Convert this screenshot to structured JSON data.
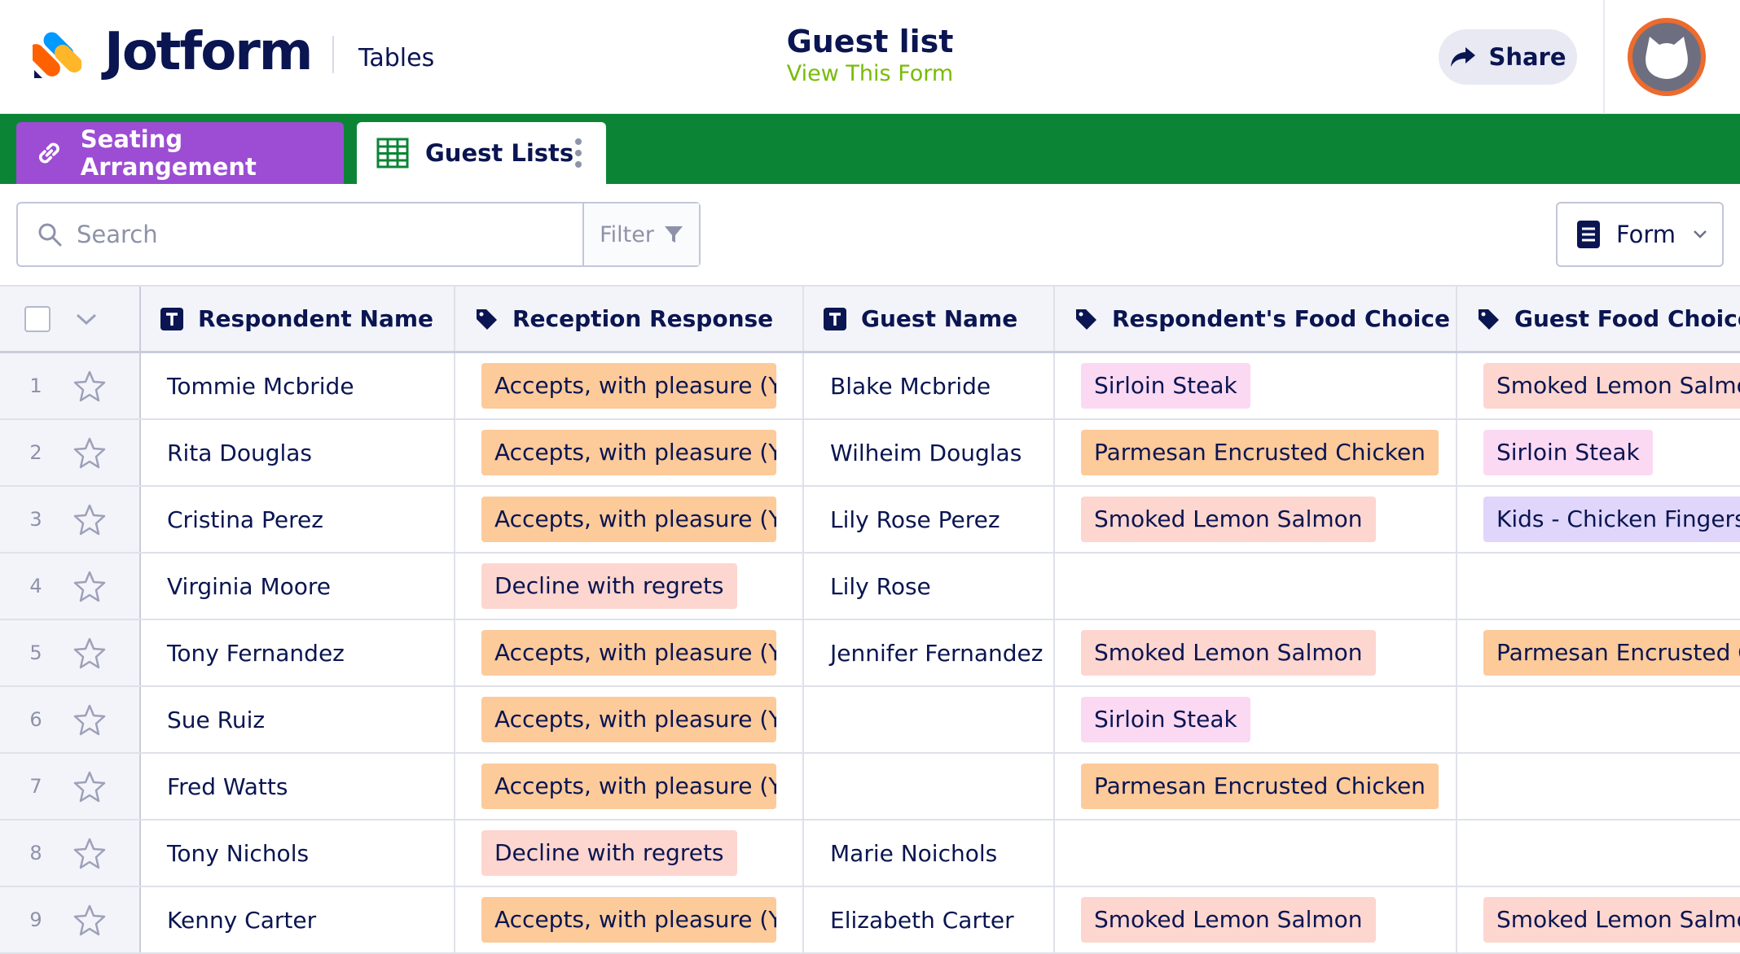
{
  "header": {
    "brand": "Jotform",
    "product": "Tables",
    "title": "Guest list",
    "view_form": "View This Form",
    "share": "Share"
  },
  "tabs": [
    {
      "label": "Seating Arrangement",
      "icon": "link-icon",
      "color": "#9c4dd3"
    },
    {
      "label": "Guest Lists",
      "icon": "grid-icon",
      "active": true
    }
  ],
  "toolbar": {
    "search_placeholder": "Search",
    "filter": "Filter",
    "form": "Form"
  },
  "columns": [
    "Respondent Name",
    "Reception Response",
    "Guest Name",
    "Respondent's Food Choice",
    "Guest Food Choice"
  ],
  "rows": [
    {
      "num": "1",
      "name": "Tommie Mcbride",
      "response": "Accepts, with pleasure (Yes)",
      "guest": "Blake Mcbride",
      "food": "Sirloin Steak",
      "guest_food": "Smoked Lemon Salmon"
    },
    {
      "num": "2",
      "name": "Rita Douglas",
      "response": "Accepts, with pleasure (Yes)",
      "guest": "Wilheim Douglas",
      "food": "Parmesan Encrusted Chicken",
      "guest_food": "Sirloin Steak"
    },
    {
      "num": "3",
      "name": "Cristina Perez",
      "response": "Accepts, with pleasure (Yes)",
      "guest": "Lily Rose Perez",
      "food": "Smoked Lemon Salmon",
      "guest_food": "Kids - Chicken Fingers & Fries"
    },
    {
      "num": "4",
      "name": "Virginia Moore",
      "response": "Decline with regrets",
      "guest": "Lily Rose",
      "food": "",
      "guest_food": ""
    },
    {
      "num": "5",
      "name": "Tony Fernandez",
      "response": "Accepts, with pleasure (Yes)",
      "guest": "Jennifer Fernandez",
      "food": "Smoked Lemon Salmon",
      "guest_food": "Parmesan Encrusted Chicken"
    },
    {
      "num": "6",
      "name": "Sue Ruiz",
      "response": "Accepts, with pleasure (Yes)",
      "guest": "",
      "food": "Sirloin Steak",
      "guest_food": ""
    },
    {
      "num": "7",
      "name": "Fred Watts",
      "response": "Accepts, with pleasure (Yes)",
      "guest": "",
      "food": "Parmesan Encrusted Chicken",
      "guest_food": ""
    },
    {
      "num": "8",
      "name": "Tony Nichols",
      "response": "Decline with regrets",
      "guest": "Marie Noichols",
      "food": "",
      "guest_food": ""
    },
    {
      "num": "9",
      "name": "Kenny Carter",
      "response": "Accepts, with pleasure (Yes)",
      "guest": "Elizabeth Carter",
      "food": "Smoked Lemon Salmon",
      "guest_food": "Smoked Lemon Salmon"
    }
  ],
  "tag_colors": {
    "Accepts, with pleasure (Yes)": "#fdca9a",
    "Decline with regrets": "#fdd6cf",
    "Sirloin Steak": "#fbd9f2",
    "Parmesan Encrusted Chicken": "#fdca9a",
    "Smoked Lemon Salmon": "#fdd6cf",
    "Kids - Chicken Fingers & Fries": "#e0d6fb"
  },
  "colors": {
    "brand_green": "#0b8535",
    "accent_lime": "#78bb07",
    "navy": "#0a1551"
  }
}
